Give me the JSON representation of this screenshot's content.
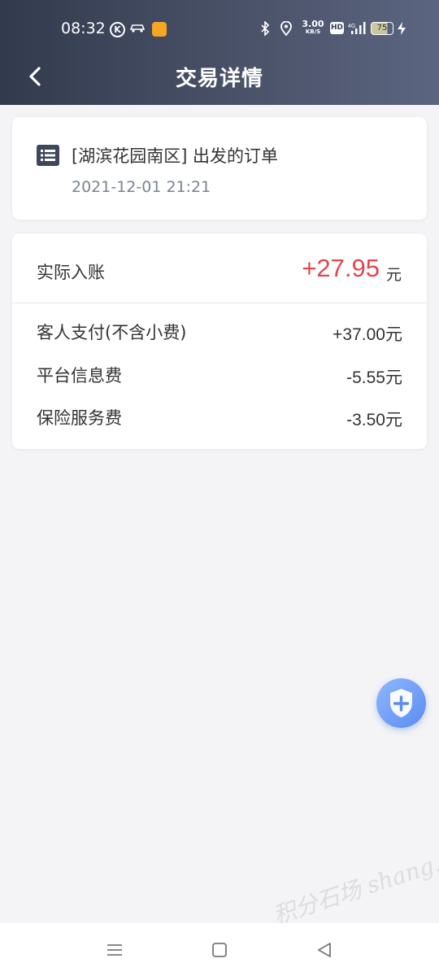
{
  "status_bar": {
    "time": "08:32",
    "k_badge": "K",
    "net_speed": "3.00",
    "net_speed_unit": "KB/S",
    "hd_label": "HD",
    "network_type": "4G",
    "battery": "75"
  },
  "header": {
    "title": "交易详情"
  },
  "order": {
    "title": "[湖滨花园南区] 出发的订单",
    "datetime": "2021-12-01 21:21"
  },
  "summary": {
    "net_label": "实际入账",
    "net_amount": "+27.95",
    "net_unit": "元",
    "rows": [
      {
        "label": "客人支付(不含小费)",
        "value": "+37.00元"
      },
      {
        "label": "平台信息费",
        "value": "-5.55元"
      },
      {
        "label": "保险服务费",
        "value": "-3.50元"
      }
    ]
  },
  "watermark": "积分石场 shang.org",
  "colors": {
    "header_start": "#323a4d",
    "header_end": "#5c6580",
    "amount_red": "#e0474f",
    "fab_blue": "#5a8df0"
  },
  "icons": [
    "back-chevron-icon",
    "list-icon",
    "shield-plus-icon",
    "menu-icon",
    "home-square-icon",
    "back-triangle-icon"
  ]
}
